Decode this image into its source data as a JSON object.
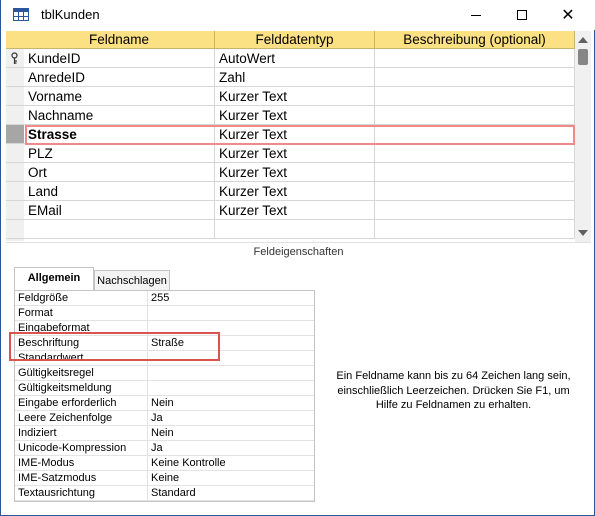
{
  "window": {
    "title": "tblKunden",
    "close_glyph": "✕"
  },
  "grid": {
    "headers": {
      "fieldname": "Feldname",
      "datatype": "Felddatentyp",
      "description": "Beschreibung (optional)"
    },
    "rows": [
      {
        "name": "KundeID",
        "type": "AutoWert",
        "description": ""
      },
      {
        "name": "AnredeID",
        "type": "Zahl",
        "description": ""
      },
      {
        "name": "Vorname",
        "type": "Kurzer Text",
        "description": ""
      },
      {
        "name": "Nachname",
        "type": "Kurzer Text",
        "description": ""
      },
      {
        "name": "Strasse",
        "type": "Kurzer Text",
        "description": ""
      },
      {
        "name": "PLZ",
        "type": "Kurzer Text",
        "description": ""
      },
      {
        "name": "Ort",
        "type": "Kurzer Text",
        "description": ""
      },
      {
        "name": "Land",
        "type": "Kurzer Text",
        "description": ""
      },
      {
        "name": "EMail",
        "type": "Kurzer Text",
        "description": ""
      }
    ],
    "primary_key_icon": "key-icon"
  },
  "properties": {
    "title": "Feldeigenschaften",
    "tabs": {
      "general": "Allgemein",
      "lookup": "Nachschlagen"
    },
    "rows": [
      {
        "label": "Feldgröße",
        "value": "255"
      },
      {
        "label": "Format",
        "value": ""
      },
      {
        "label": "Eingabeformat",
        "value": ""
      },
      {
        "label": "Beschriftung",
        "value": "Straße"
      },
      {
        "label": "Standardwert",
        "value": ""
      },
      {
        "label": "Gültigkeitsregel",
        "value": ""
      },
      {
        "label": "Gültigkeitsmeldung",
        "value": ""
      },
      {
        "label": "Eingabe erforderlich",
        "value": "Nein"
      },
      {
        "label": "Leere Zeichenfolge",
        "value": "Ja"
      },
      {
        "label": "Indiziert",
        "value": "Nein"
      },
      {
        "label": "Unicode-Kompression",
        "value": "Ja"
      },
      {
        "label": "IME-Modus",
        "value": "Keine Kontrolle"
      },
      {
        "label": "IME-Satzmodus",
        "value": "Keine"
      },
      {
        "label": "Textausrichtung",
        "value": "Standard"
      }
    ],
    "help": "Ein Feldname kann bis zu 64 Zeichen lang sein, einschließlich Leerzeichen. Drücken Sie F1, um Hilfe zu Feldnamen zu erhalten."
  },
  "colors": {
    "header": "#fbe084",
    "accent": "#2b579a",
    "row_highlight": "#f08a8a",
    "prop_highlight": "#d9534f"
  }
}
